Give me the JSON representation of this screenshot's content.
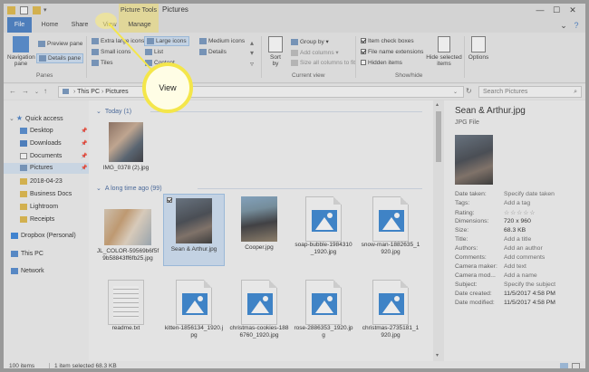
{
  "window": {
    "title": "Pictures",
    "contextual_tab": "Picture Tools"
  },
  "tabs": {
    "file": "File",
    "home": "Home",
    "share": "Share",
    "view": "View",
    "manage": "Manage"
  },
  "ribbon": {
    "panes": {
      "navigation_pane": "Navigation pane",
      "preview_pane": "Preview pane",
      "details_pane": "Details pane",
      "label": "Panes"
    },
    "layout": {
      "extra_large_icons": "Extra large icons",
      "large_icons": "Large icons",
      "medium_icons": "Medium icons",
      "small_icons": "Small icons",
      "list": "List",
      "details": "Details",
      "tiles": "Tiles",
      "content": "Content"
    },
    "current_view": {
      "sort_by": "Sort by",
      "group_by": "Group by",
      "add_columns": "Add columns",
      "size_all_columns": "Size all columns to fit",
      "label": "Current view"
    },
    "show_hide": {
      "item_check_boxes": "Item check boxes",
      "file_name_extensions": "File name extensions",
      "hidden_items": "Hidden items",
      "hide_selected_items": "Hide selected items",
      "label": "Show/hide"
    },
    "options": "Options"
  },
  "address": {
    "path": [
      "This PC",
      "Pictures"
    ],
    "search_placeholder": "Search Pictures"
  },
  "nav": {
    "quick_access": "Quick access",
    "desktop": "Desktop",
    "downloads": "Downloads",
    "documents": "Documents",
    "pictures": "Pictures",
    "folder_1": "2018-04-23",
    "folder_2": "Business Docs",
    "folder_3": "Lightroom",
    "folder_4": "Receipts",
    "dropbox": "Dropbox (Personal)",
    "this_pc": "This PC",
    "network": "Network"
  },
  "groups": {
    "today": "Today (1)",
    "long_ago": "A long time ago (99)"
  },
  "files": {
    "f1": "IMG_0378 (2).jpg",
    "f2": "JL_COLOR-59569b6f5f9b58843ff6fb25.jpg",
    "f3": "Sean & Arthur.jpg",
    "f4": "Cooper.jpg",
    "f5": "soap-bubble-1984310_1920.jpg",
    "f6": "snow-man-1882635_1920.jpg",
    "f7": "readme.txt",
    "f8": "kitten-1856134_1920.jpg",
    "f9": "christmas-cookies-1886760_1920.jpg",
    "f10": "rose-2886353_1920.jpg",
    "f11": "christmas-2735181_1920.jpg"
  },
  "details": {
    "name": "Sean & Arthur.jpg",
    "type": "JPG File",
    "props": {
      "date_taken": {
        "k": "Date taken:",
        "v": "Specify date taken"
      },
      "tags": {
        "k": "Tags:",
        "v": "Add a tag"
      },
      "rating": {
        "k": "Rating:",
        "v": "☆☆☆☆☆"
      },
      "dimensions": {
        "k": "Dimensions:",
        "v": "720 x 960"
      },
      "size": {
        "k": "Size:",
        "v": "68.3 KB"
      },
      "title": {
        "k": "Title:",
        "v": "Add a title"
      },
      "authors": {
        "k": "Authors:",
        "v": "Add an author"
      },
      "comments": {
        "k": "Comments:",
        "v": "Add comments"
      },
      "camera_maker": {
        "k": "Camera maker:",
        "v": "Add text"
      },
      "camera_model": {
        "k": "Camera mod...",
        "v": "Add a name"
      },
      "subject": {
        "k": "Subject:",
        "v": "Specify the subject"
      },
      "date_created": {
        "k": "Date created:",
        "v": "11/5/2017 4:58 PM"
      },
      "date_modified": {
        "k": "Date modified:",
        "v": "11/5/2017 4:58 PM"
      }
    }
  },
  "status": {
    "item_count": "100 items",
    "selection": "1 item selected  68.3 KB"
  },
  "callout": "View",
  "colors": {
    "accent": "#3f79c4",
    "callout_ring": "#f4e64a",
    "context_tab": "#f2e69a"
  }
}
